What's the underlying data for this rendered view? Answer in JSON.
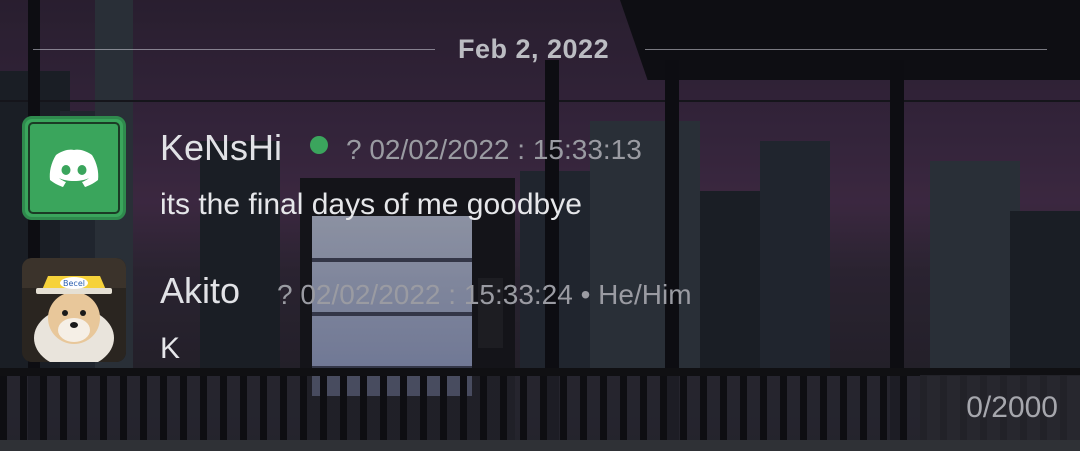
{
  "chat": {
    "date_divider": "Feb 2, 2022",
    "messages": [
      {
        "author": "KeNsHi",
        "online": true,
        "timestamp": "? 02/02/2022 : 15:33:13",
        "text": "its the final days of me goodbye",
        "avatar": "discord-logo-icon"
      },
      {
        "author": "Akito",
        "timestamp": "? 02/02/2022 : 15:33:24 • He/Him",
        "text": "K",
        "avatar": "shiba-dog-avatar"
      }
    ]
  },
  "composer": {
    "char_counter": "0/2000"
  },
  "colors": {
    "online_status": "#3ba55d",
    "discord_avatar_bg": "#3aa55c"
  }
}
